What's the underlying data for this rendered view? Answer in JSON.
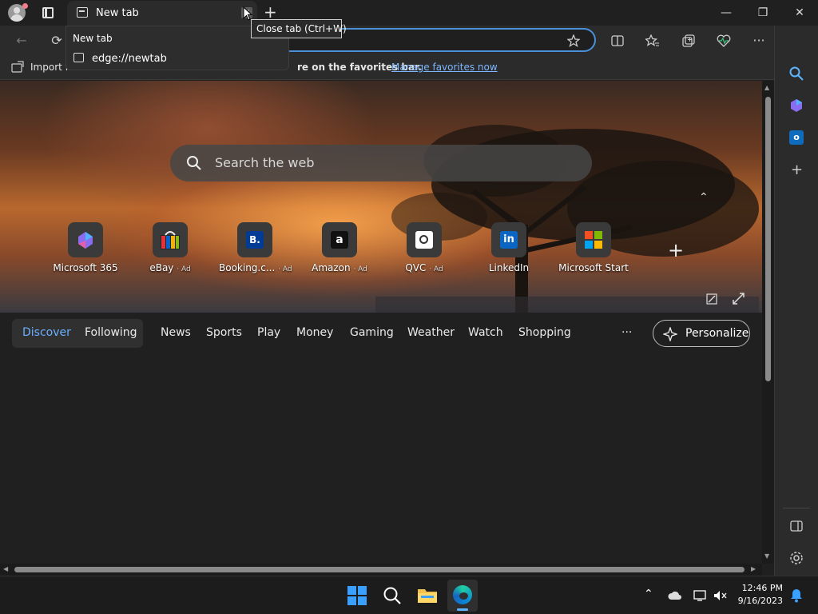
{
  "tab": {
    "title": "New tab",
    "close_glyph": "×"
  },
  "tooltip": {
    "text": "Close tab (Ctrl+W)"
  },
  "dropdown": {
    "title": "New tab",
    "url": "edge://newtab"
  },
  "window": {
    "minimize": "—",
    "maximize": "❐",
    "close": "✕"
  },
  "favorites_bar": {
    "import_text": "Import f",
    "middle_text": "re on the favorites bar.",
    "manage_link": "Manage favorites now"
  },
  "search": {
    "placeholder": "Search the web"
  },
  "quick_links": [
    {
      "label": "Microsoft 365",
      "ad": ""
    },
    {
      "label": "eBay",
      "ad": "· Ad"
    },
    {
      "label": "Booking.c...",
      "ad": "· Ad"
    },
    {
      "label": "Amazon",
      "ad": "· Ad"
    },
    {
      "label": "QVC",
      "ad": "· Ad"
    },
    {
      "label": "LinkedIn",
      "ad": ""
    },
    {
      "label": "Microsoft Start",
      "ad": ""
    }
  ],
  "feed_nav": {
    "discover": "Discover",
    "following": "Following",
    "items": [
      "News",
      "Sports",
      "Play",
      "Money",
      "Gaming",
      "Weather",
      "Watch",
      "Shopping"
    ],
    "more": "···",
    "personalize": "Personalize"
  },
  "taskbar": {
    "time": "12:46 PM",
    "date": "9/16/2023"
  },
  "colors": {
    "accent": "#4a90d9",
    "link": "#7cb7ff",
    "discover": "#6ab0ff"
  }
}
